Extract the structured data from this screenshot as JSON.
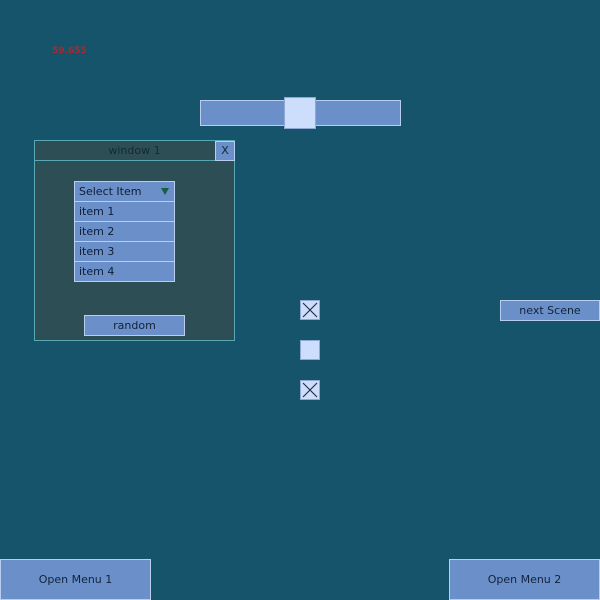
{
  "fps_counter": "59.655",
  "slider": {
    "value": 0.5
  },
  "window": {
    "title": "window 1",
    "close_label": "X",
    "dropdown": {
      "selected": "Select Item",
      "icon": "triangle-down-icon",
      "options": [
        "item 1",
        "item 2",
        "item 3",
        "item 4"
      ]
    },
    "random_label": "random"
  },
  "checkboxes": [
    {
      "checked": true
    },
    {
      "checked": false
    },
    {
      "checked": true
    }
  ],
  "next_scene_label": "next Scene",
  "open_menu_1_label": "Open Menu 1",
  "open_menu_2_label": "Open Menu 2",
  "colors": {
    "background": "#15546b",
    "button": "#6a8fc9",
    "window": "#2e4e55",
    "fps_text": "#b3252c"
  }
}
